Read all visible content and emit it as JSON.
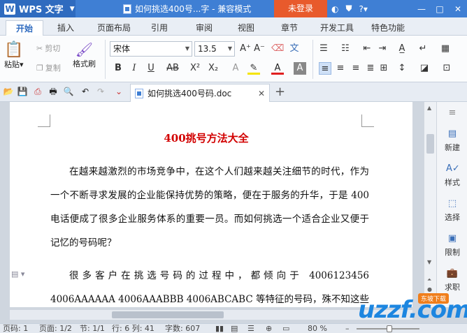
{
  "titlebar": {
    "app_name": "WPS 文字",
    "doc_title": "如何挑选400号...字 - 兼容模式",
    "login_label": "未登录",
    "help_label": "?",
    "icons": [
      "skin-icon",
      "shirt-icon",
      "help-icon"
    ],
    "window_controls": [
      "—",
      "□",
      "✕"
    ]
  },
  "tabs": [
    "开始",
    "插入",
    "页面布局",
    "引用",
    "审阅",
    "视图",
    "章节",
    "开发工具",
    "特色功能"
  ],
  "ribbon": {
    "paste_label": "粘贴",
    "cut_label": "剪切",
    "copy_label": "复制",
    "format_painter_label": "格式刷",
    "font_name": "宋体",
    "font_size": "13.5"
  },
  "doc_tab": {
    "filename": "如何挑选400号码.doc",
    "close_label": "✕",
    "new_tab_label": "+"
  },
  "document": {
    "heading": "400挑号方法大全",
    "paragraph1": "在越来越激烈的市场竞争中，在这个人们越来越关注细节的时代，作为一个不断寻求发展的企业能保持优势的策略，便在于服务的升华，于是 400 电话便成了很多企业服务体系的重要一员。而如何挑选一个适合企业又便于记忆的号码呢？",
    "paragraph2": "很多客户在挑选号码的过程中，都倾向于 4006123456 4006AAAAAA 4006AAABBB 4006ABCABC 等特征的号码，殊不知这些特殊组合的号码"
  },
  "task_panel": {
    "items": [
      "新建",
      "样式",
      "选择",
      "限制",
      "求职"
    ]
  },
  "statusbar": {
    "page_num": "页码: 1",
    "pages": "页面: 1/2",
    "section": "节: 1/1",
    "row_col": "行: 6  列: 41",
    "word_count": "字数: 607",
    "zoom": "80 %"
  },
  "watermark": {
    "brand": "uzzf.com",
    "badge": "东坡下载"
  }
}
